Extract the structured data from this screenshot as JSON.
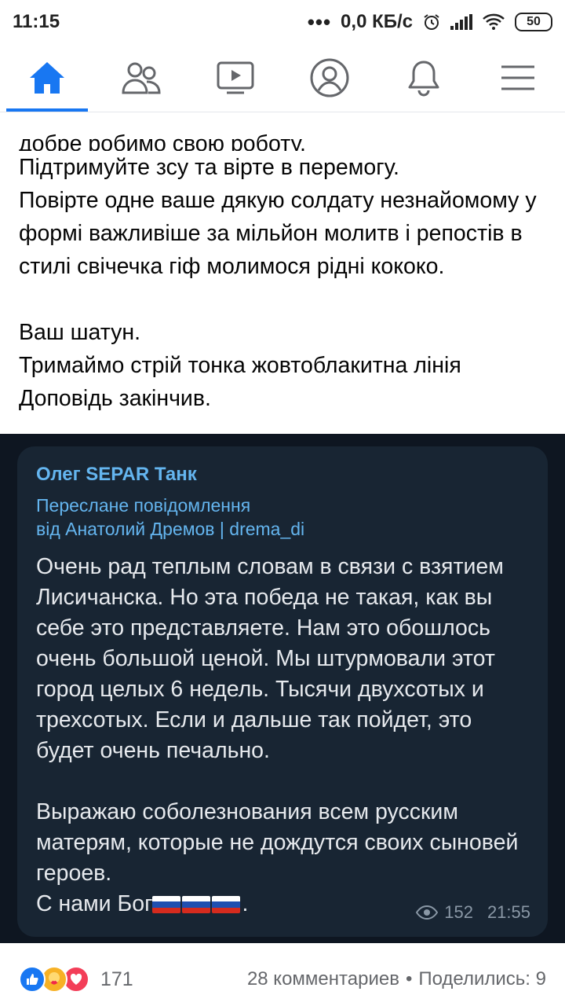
{
  "status_bar": {
    "time": "11:15",
    "dots": "•••",
    "network_speed": "0,0 КБ/с",
    "battery": "50"
  },
  "nav": {
    "items": [
      {
        "icon": "home-icon",
        "active": true
      },
      {
        "icon": "friends-icon"
      },
      {
        "icon": "video-icon"
      },
      {
        "icon": "profile-icon"
      },
      {
        "icon": "notifications-icon"
      },
      {
        "icon": "menu-icon"
      }
    ],
    "accent": "#1877f2"
  },
  "post": {
    "clipped_line": "добре робимо свою роботу.",
    "text": "Підтримуйте зсу та вірте в перемогу.\nПовірте одне ваше дякую солдату незнайомому у формі важливіше за мільйон молитв і репостів в стилі свічечка гіф молимося рідні кококо.\n\nВаш шатун.\nТримаймо стрій тонка жовтоблакитна лінія\nДоповідь закінчив."
  },
  "telegram": {
    "sender": "Олег SEPAR Танк",
    "forwarded_label": "Переслане повідомлення",
    "forwarded_from": "від Анатолий Дремов | drema_di",
    "message": "Очень рад теплым словам в связи с взятием Лисичанска.  Но эта победа не такая, как вы себе это представляете. Нам это обошлось очень большой ценой. Мы штурмовали этот город целых 6 недель.  Тысячи двухсотых и трехсотых. Если и дальше так пойдет, это будет очень печально.\n\nВыражаю соболезнования всем русским матерям, которые не дождутся своих сыновей героев.",
    "last_line": "С нами Бог",
    "last_line_end": ".",
    "views": "152",
    "time": "21:55"
  },
  "footer": {
    "reaction_count": "171",
    "comments": "28 комментариев",
    "separator": "•",
    "shares": "Поделились: 9"
  }
}
